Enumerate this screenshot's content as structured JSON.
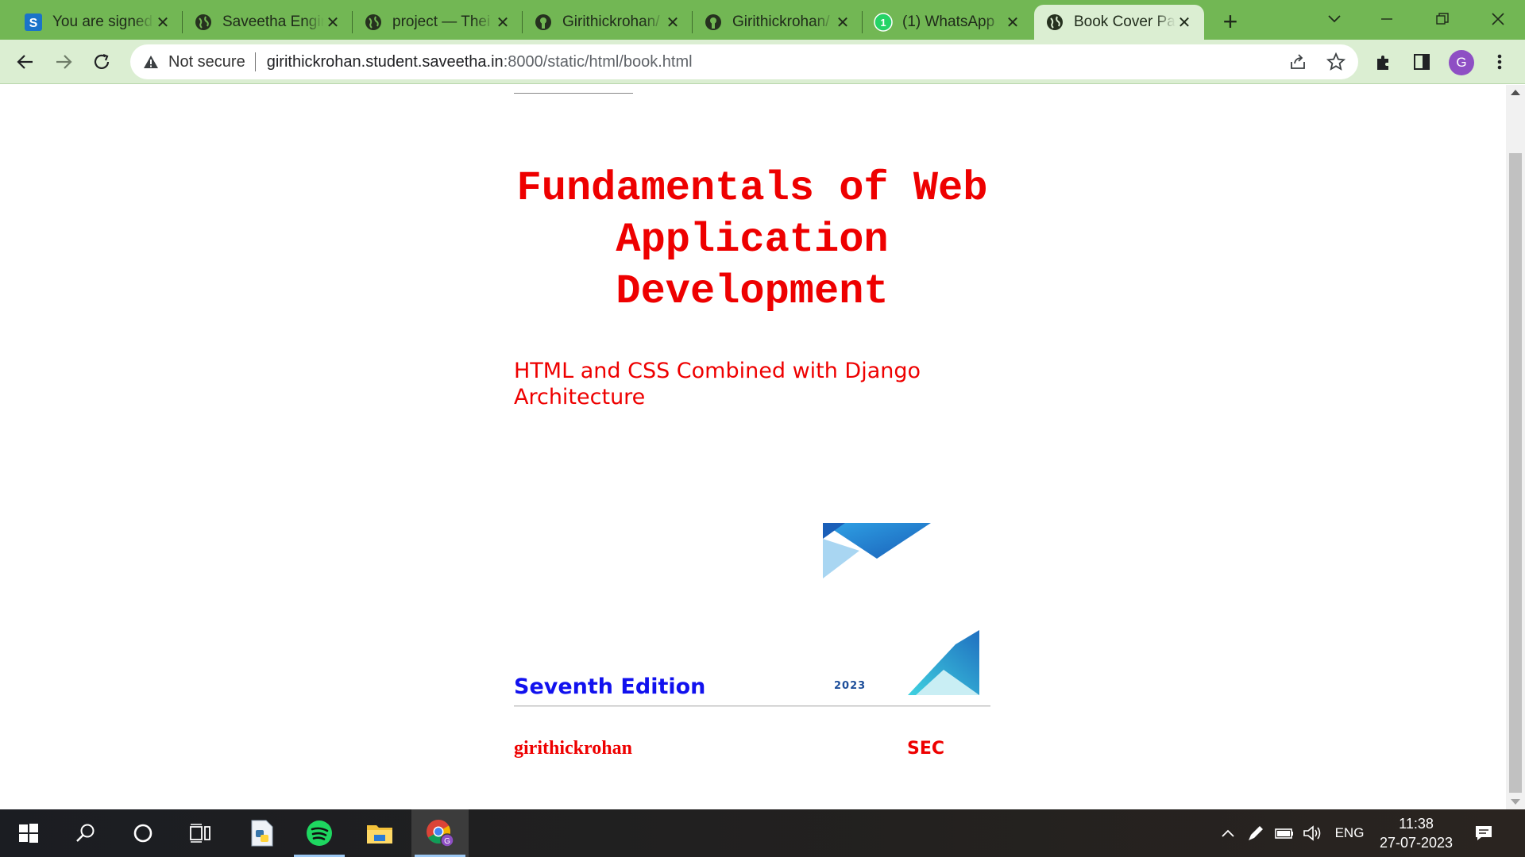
{
  "browser": {
    "tabs": [
      {
        "title": "You are signed",
        "icon": "s-app-icon"
      },
      {
        "title": "Saveetha Engir",
        "icon": "globe-icon"
      },
      {
        "title": "project — Thei",
        "icon": "globe-icon"
      },
      {
        "title": "Girithickrohan/",
        "icon": "github-icon"
      },
      {
        "title": "Girithickrohan/",
        "icon": "github-icon"
      },
      {
        "title": "(1) WhatsApp",
        "icon": "whatsapp-icon"
      },
      {
        "title": "Book Cover Pa",
        "icon": "globe-icon",
        "active": true
      }
    ],
    "security_label": "Not secure",
    "url_host": "girithickrohan.student.saveetha.in",
    "url_rest": ":8000/static/html/book.html",
    "profile_initial": "G",
    "accent_color": "#72b754"
  },
  "page": {
    "title": "Fundamentals of Web Application Development",
    "subtitle": "HTML and CSS Combined with Django Architecture",
    "edition": "Seventh Edition",
    "year": "2023",
    "author": "girithickrohan",
    "publisher": "SEC",
    "title_color": "#ee0000",
    "edition_color": "#1111ee"
  },
  "taskbar": {
    "apps": [
      "windows-start-icon",
      "search-icon",
      "cortana-icon",
      "task-view-icon",
      "python-file-icon",
      "spotify-icon",
      "file-explorer-icon",
      "chrome-icon"
    ],
    "language": "ENG",
    "time": "11:38",
    "date": "27-07-2023"
  }
}
